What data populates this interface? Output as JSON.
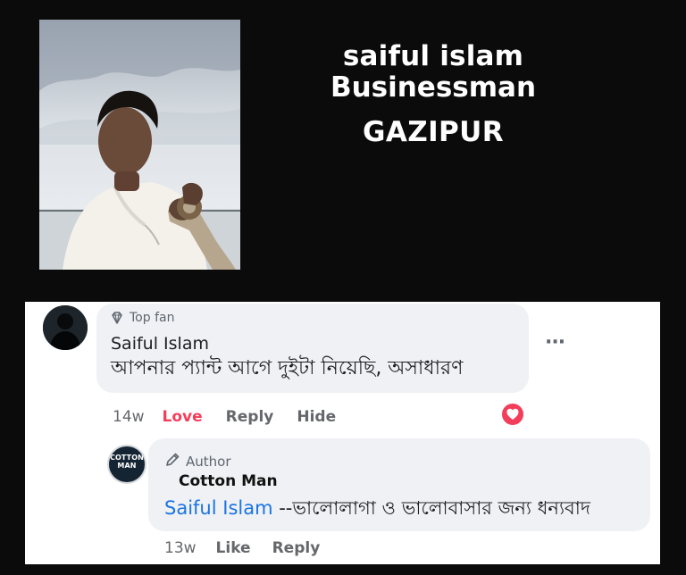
{
  "profile": {
    "name": "saiful islam",
    "role": "Businessman",
    "city": "GAZIPUR"
  },
  "comment": {
    "badge": "Top fan",
    "author": "Saiful Islam",
    "text": "আপনার প্যান্ট আগে দুইটা নিয়েছি, অসাধারণ",
    "time": "14w",
    "love_label": "Love",
    "reply_label": "Reply",
    "hide_label": "Hide",
    "more_label": "···"
  },
  "reply": {
    "badge": "Author",
    "author": "Cotton Man",
    "mention": "Saiful Islam",
    "text": " --ভালোলাগা ও ভালোবাসার জন্য ধন্যবাদ",
    "time": "13w",
    "like_label": "Like",
    "reply_label": "Reply",
    "avatar_text_line1": "COTTON",
    "avatar_text_line2": "MAN"
  },
  "colors": {
    "page_background": "#0b0b0b",
    "panel_background": "#ffffff",
    "bubble_background": "#eff1f4",
    "love_color": "#f33e5b",
    "mention_color": "#1b74e4"
  },
  "icons": {
    "top_fan": "diamond-icon",
    "author": "pencil-icon",
    "more": "more-options-icon",
    "reaction": "heart-icon"
  }
}
